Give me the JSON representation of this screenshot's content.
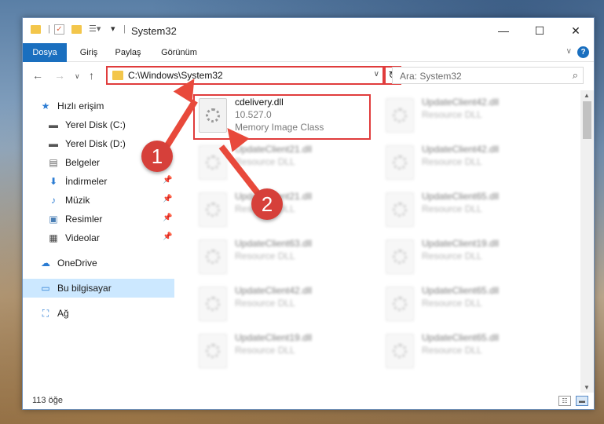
{
  "window": {
    "title": "System32"
  },
  "ribbon": {
    "tabs": [
      "Dosya",
      "Giriş",
      "Paylaş",
      "Görünüm"
    ],
    "help_label": "?"
  },
  "nav": {
    "address_path": "C:\\Windows\\System32",
    "search_placeholder": "Ara: System32"
  },
  "sidebar": {
    "items": [
      {
        "label": "Hızlı erişim",
        "icon": "star-icon",
        "pinned": false
      },
      {
        "label": "Yerel Disk (C:)",
        "icon": "drive-icon",
        "pinned": true
      },
      {
        "label": "Yerel Disk (D:)",
        "icon": "drive-icon",
        "pinned": true
      },
      {
        "label": "Belgeler",
        "icon": "document-icon",
        "pinned": true
      },
      {
        "label": "İndirmeler",
        "icon": "download-icon",
        "pinned": true
      },
      {
        "label": "Müzik",
        "icon": "music-icon",
        "pinned": true
      },
      {
        "label": "Resimler",
        "icon": "pictures-icon",
        "pinned": true
      },
      {
        "label": "Videolar",
        "icon": "video-icon",
        "pinned": true
      },
      {
        "label": "OneDrive",
        "icon": "cloud-icon",
        "pinned": false
      },
      {
        "label": "Bu bilgisayar",
        "icon": "computer-icon",
        "pinned": false,
        "selected": true
      },
      {
        "label": "Ağ",
        "icon": "network-icon",
        "pinned": false
      }
    ]
  },
  "files": {
    "highlighted": {
      "name": "cdelivery.dll",
      "version": "10.527.0",
      "description": "Memory Image Class"
    },
    "left_column": [
      {
        "name": "UpdateClient21.dll",
        "type": "Resource DLL"
      },
      {
        "name": "UpdateClient21.dll",
        "type": "Resource DLL"
      },
      {
        "name": "UpdateClient63.dll",
        "type": "Resource DLL"
      },
      {
        "name": "UpdateClient42.dll",
        "type": "Resource DLL"
      },
      {
        "name": "UpdateClient19.dll",
        "type": "Resource DLL"
      }
    ],
    "right_column": [
      {
        "name": "UpdateClient42.dll",
        "type": "Resource DLL"
      },
      {
        "name": "UpdateClient42.dll",
        "type": "Resource DLL"
      },
      {
        "name": "UpdateClient65.dll",
        "type": "Resource DLL"
      },
      {
        "name": "UpdateClient19.dll",
        "type": "Resource DLL"
      },
      {
        "name": "UpdateClient65.dll",
        "type": "Resource DLL"
      },
      {
        "name": "UpdateClient65.dll",
        "type": "Resource DLL"
      }
    ]
  },
  "status": {
    "item_count": "113 öğe"
  },
  "annotations": {
    "callout_1": "1",
    "callout_2": "2",
    "color": "#d6403a"
  }
}
